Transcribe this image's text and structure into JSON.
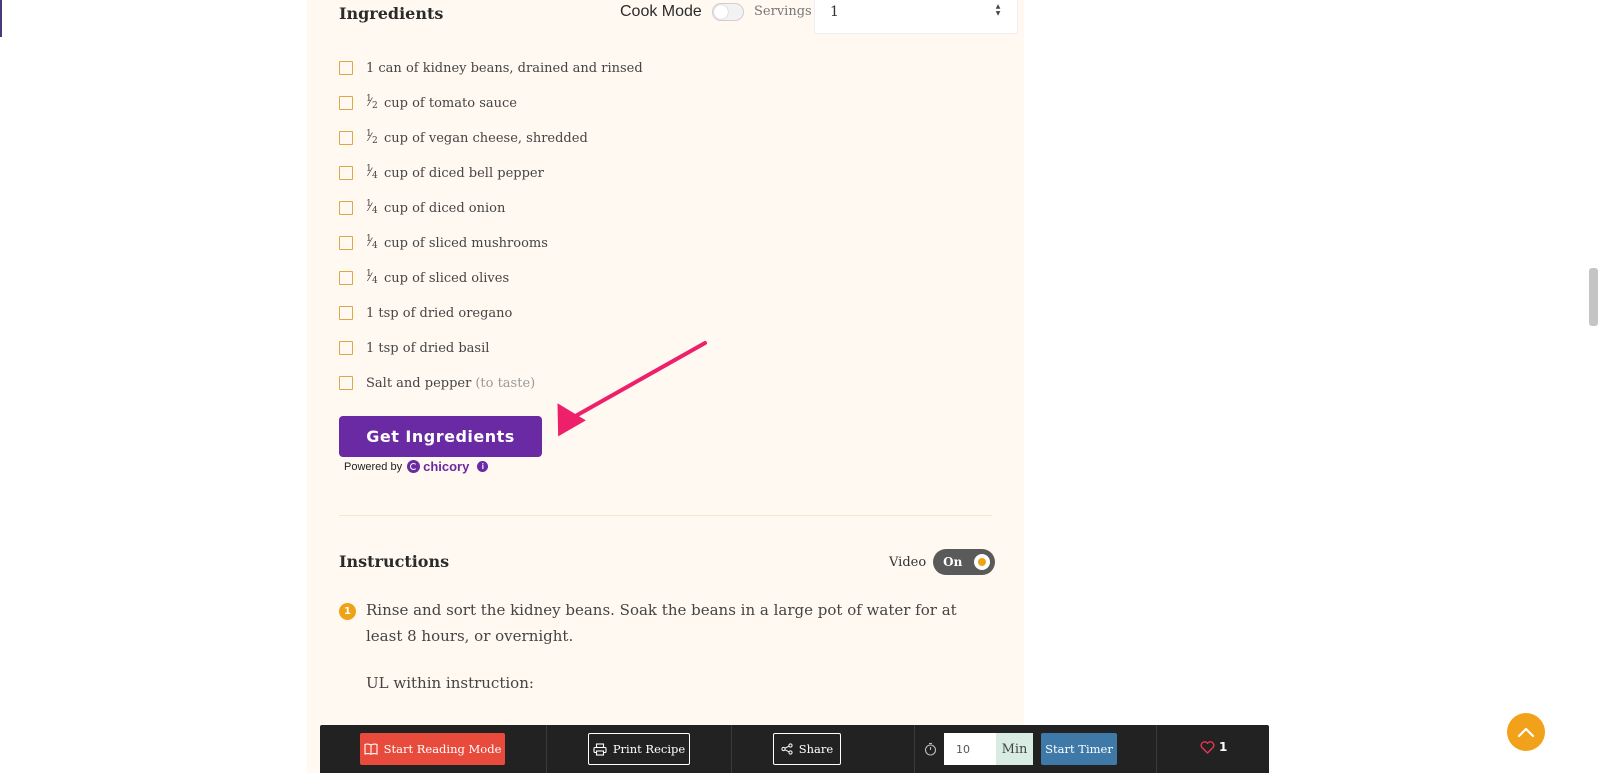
{
  "ingredients": {
    "title": "Ingredients",
    "cook_mode_label": "Cook Mode",
    "servings_label": "Servings",
    "servings_value": "1",
    "items": [
      {
        "whole": "",
        "num": "",
        "den": "",
        "text": "1 can of kidney beans, drained and rinsed",
        "note": ""
      },
      {
        "num": "1",
        "den": "2",
        "text": "cup of tomato sauce",
        "note": ""
      },
      {
        "num": "1",
        "den": "2",
        "text": "cup of vegan cheese, shredded",
        "note": ""
      },
      {
        "num": "1",
        "den": "4",
        "text": "cup of diced bell pepper",
        "note": ""
      },
      {
        "num": "1",
        "den": "4",
        "text": "cup of diced onion",
        "note": ""
      },
      {
        "num": "1",
        "den": "4",
        "text": "cup of sliced mushrooms",
        "note": ""
      },
      {
        "num": "1",
        "den": "4",
        "text": "cup of sliced olives",
        "note": ""
      },
      {
        "num": "",
        "den": "",
        "text": "1 tsp of dried oregano",
        "note": ""
      },
      {
        "num": "",
        "den": "",
        "text": "1 tsp of dried basil",
        "note": ""
      },
      {
        "num": "",
        "den": "",
        "text": "Salt and pepper",
        "note": "(to taste)"
      }
    ],
    "get_button": "Get Ingredients",
    "powered_by": "Powered by",
    "brand": "chicory",
    "info_glyph": "i"
  },
  "instructions": {
    "title": "Instructions",
    "video_label": "Video",
    "video_toggle": "On",
    "steps": [
      {
        "number": "1",
        "text": "Rinse and sort the kidney beans. Soak the beans in a large pot of water for at least 8 hours, or overnight."
      }
    ],
    "ul_text": "UL within instruction:"
  },
  "bottom_bar": {
    "reading_mode": "Start Reading Mode",
    "print": "Print Recipe",
    "share": "Share",
    "timer_value": "10",
    "timer_unit": "Min",
    "start_timer": "Start Timer",
    "likes": "1"
  },
  "icons": {
    "book": "book-icon",
    "printer": "printer-icon",
    "share": "share-icon",
    "stopwatch": "stopwatch-icon",
    "heart": "heart-icon",
    "chevron_up": "chevron-up-icon",
    "arrow": "annotation-arrow"
  },
  "colors": {
    "card_bg": "#fff9f1",
    "checkbox": "#e0a64a",
    "get_button": "#6a2aa3",
    "accent": "#eea316",
    "reading_mode": "#e84b3c",
    "timer_button": "#3e79a8",
    "bottom_bar": "#222222",
    "arrow": "#ee1f6b"
  }
}
